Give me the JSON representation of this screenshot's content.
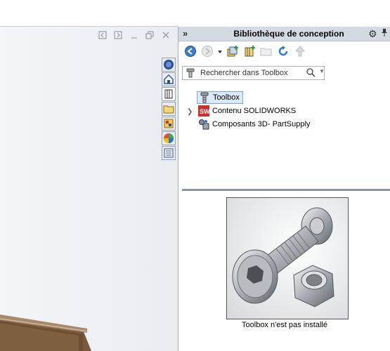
{
  "viewport": {
    "window_controls": [
      "restore-left",
      "restore-right",
      "minimize",
      "maximize",
      "close"
    ]
  },
  "side_tabs": [
    "solidworks-resources-icon",
    "home-icon",
    "design-library-icon",
    "file-explorer-icon",
    "view-palette-icon",
    "appearances-icon",
    "custom-properties-icon"
  ],
  "panel": {
    "collapse_glyph": "»",
    "title": "Bibliothèque de conception",
    "search": {
      "placeholder": "Rechercher dans Toolbox"
    },
    "tree": [
      {
        "label": "Toolbox",
        "icon": "toolbox-icon",
        "selected": true
      },
      {
        "label": "Contenu SOLIDWORKS",
        "icon": "solidworks-content-icon",
        "expandable": true
      },
      {
        "label": "Composants 3D- PartSupply",
        "icon": "partsupply-icon"
      }
    ],
    "preview_caption": "Toolbox n'est pas installé"
  },
  "colors": {
    "header_bg": "#d5dae1",
    "selection_bg": "#dbe8f7",
    "selection_border": "#7ba3d6"
  }
}
